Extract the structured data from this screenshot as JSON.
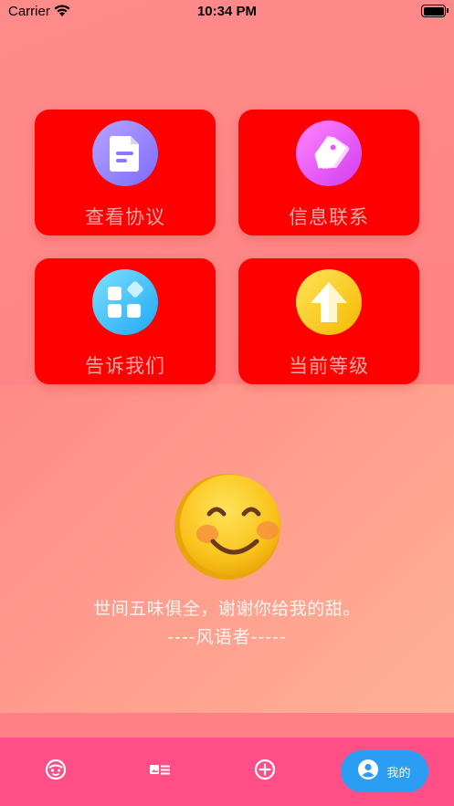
{
  "status_bar": {
    "carrier": "Carrier",
    "time": "10:34 PM"
  },
  "menu": {
    "items": [
      {
        "label": "查看协议",
        "icon": "document-icon",
        "color": "#7c6bff"
      },
      {
        "label": "信息联系",
        "icon": "tag-icon",
        "color": "#d23bf0"
      },
      {
        "label": "告诉我们",
        "icon": "grid-icon",
        "color": "#1fa8f5"
      },
      {
        "label": "当前等级",
        "icon": "up-arrow-icon",
        "color": "#f5b800"
      }
    ],
    "card_color": "#ff0000"
  },
  "quote": {
    "line1": "世间五味俱全，谢谢你给我的甜。",
    "line2": "----风语者-----"
  },
  "tabbar": {
    "tabs": [
      {
        "icon": "face-icon"
      },
      {
        "icon": "id-card-icon"
      },
      {
        "icon": "plus-circle-icon"
      },
      {
        "icon": "user-icon",
        "label": "我的",
        "active": true
      }
    ],
    "bg_color": "#ff4f86",
    "active_color": "#2b9df2"
  }
}
